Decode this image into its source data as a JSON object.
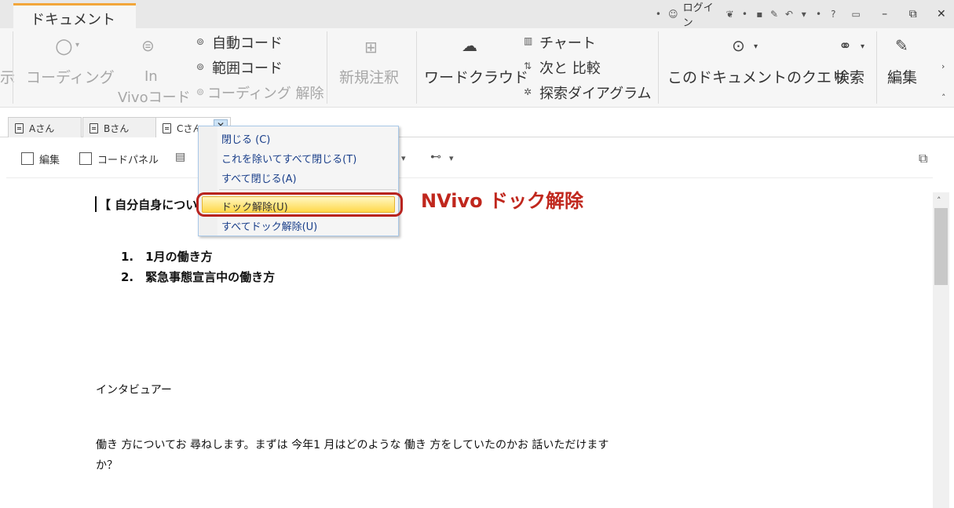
{
  "window": {
    "doc_tab_label": "ドキュメント",
    "login_label": "ログイン",
    "help_label": "?",
    "minimize": "–",
    "restore": "⧉",
    "close": "✕"
  },
  "ribbon": {
    "cut_label": "示",
    "coding_label": "コーディング",
    "in_vivo_line1": "In",
    "in_vivo_line2": "Vivoコード",
    "auto_code": "自動コード",
    "range_code": "範囲コード",
    "uncode": "コーディング 解除",
    "new_annotation": "新規注釈",
    "word_cloud": "ワードクラウド",
    "chart": "チャート",
    "compare": "次と 比較",
    "explore_diagram": "探索ダイアグラム",
    "query_doc": "このドキュメントのクエリ",
    "search": "検索",
    "edit": "編集"
  },
  "tabs": [
    {
      "label": "Aさん"
    },
    {
      "label": "Bさん"
    },
    {
      "label": "Cさん"
    }
  ],
  "toolbar": {
    "edit_label": "編集",
    "code_panel_label": "コードパネル"
  },
  "context_menu": {
    "items": [
      {
        "label": "閉じる (C)"
      },
      {
        "label": "これを除いてすべて閉じる(T)"
      },
      {
        "label": "すべて閉じる(A)"
      },
      {
        "label": "ドック解除(U)"
      },
      {
        "label": "すべてドック解除(U)"
      }
    ]
  },
  "annotation": {
    "text": "NVivo ドック解除",
    "color": "#c0271d"
  },
  "document": {
    "heading": "【 自分自身につい",
    "list_1": "1.　1月の働き方",
    "list_2": "2.　緊急事態宣言中の働き方",
    "interviewer": "インタビュアー",
    "question_line1": "働き 方についてお 尋ねします。まずは 今年1 月はどのような 働き 方をしていたのかお 話いただけます",
    "question_line2": "か？"
  }
}
